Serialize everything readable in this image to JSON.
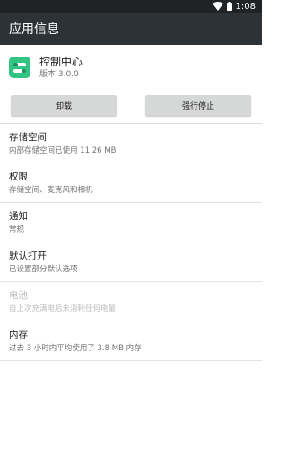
{
  "status_bar": {
    "time": "1:08"
  },
  "app_bar": {
    "title": "应用信息"
  },
  "app": {
    "name": "控制中心",
    "version": "版本 3.0.0",
    "icon": "toggle-switch-icon"
  },
  "buttons": {
    "uninstall": "卸载",
    "force_stop": "强行停止"
  },
  "items": [
    {
      "title": "存储空间",
      "subtitle": "内部存储空间已使用 11.26 MB"
    },
    {
      "title": "权限",
      "subtitle": "存储空间、麦克风和相机"
    },
    {
      "title": "通知",
      "subtitle": "常规"
    },
    {
      "title": "默认打开",
      "subtitle": "已设置部分默认选项"
    },
    {
      "title": "电池",
      "subtitle": "自上次充满电后未消耗任何电量"
    },
    {
      "title": "内存",
      "subtitle": "过去 3 小时内平均使用了 3.8 MB 内存"
    }
  ],
  "colors": {
    "status_bar": "#1f2326",
    "app_bar": "#2d3236",
    "app_icon": "#32c483",
    "button_bg": "#d6d7d7"
  }
}
